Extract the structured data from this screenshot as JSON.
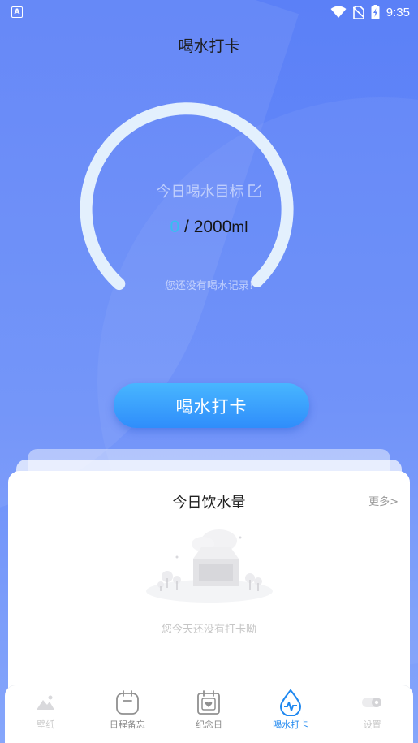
{
  "status_bar": {
    "app_badge": "A",
    "time": "9:35",
    "icons": [
      "wifi-icon",
      "no-sim-icon",
      "battery-charging-icon"
    ]
  },
  "page": {
    "title": "喝水打卡"
  },
  "gauge": {
    "goal_label": "今日喝水目标",
    "current_ml": "0",
    "separator": " / ",
    "target_ml": "2000",
    "unit": "ml",
    "progress": 0,
    "no_record_text": "您还没有喝水记录!",
    "colors": {
      "track": "#e3f0fd",
      "accent": "#35c0f0"
    }
  },
  "checkin_button": {
    "label": "喝水打卡"
  },
  "today_card": {
    "title": "今日饮水量",
    "more_label": "更多>",
    "empty_text": "您今天还没有打卡呦"
  },
  "tabbar": {
    "items": [
      {
        "label": "壁纸",
        "icon": "mountain-image-icon",
        "active": false
      },
      {
        "label": "日程备忘",
        "icon": "calendar-icon",
        "active": false
      },
      {
        "label": "纪念日",
        "icon": "heart-calendar-icon",
        "active": false
      },
      {
        "label": "喝水打卡",
        "icon": "water-drop-pulse-icon",
        "active": true
      },
      {
        "label": "设置",
        "icon": "gear-icon",
        "active": false
      }
    ],
    "active_color": "#1f88f0"
  }
}
